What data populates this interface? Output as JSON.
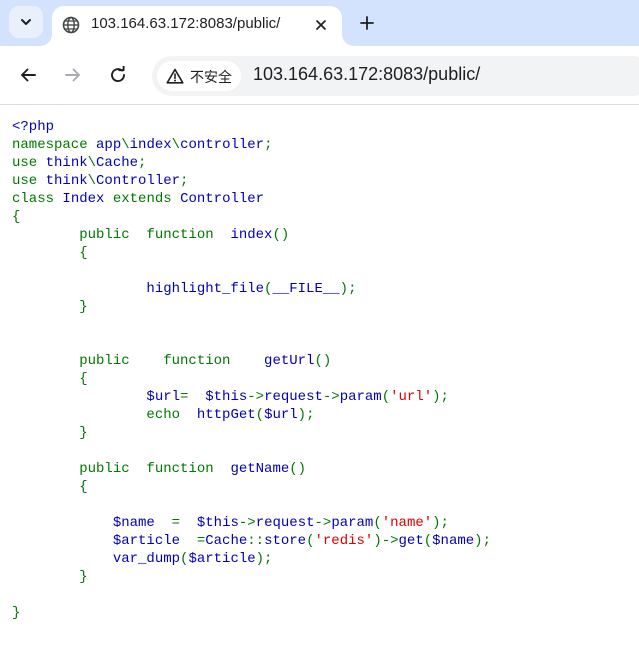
{
  "browser": {
    "tab": {
      "title": "103.164.63.172:8083/public/",
      "favicon": "globe-icon",
      "close": "close-icon"
    },
    "new_tab": "plus-icon",
    "tab_search": "chevron-down-icon",
    "nav": {
      "back": "back-arrow-icon",
      "forward": "forward-arrow-icon",
      "reload": "reload-icon"
    },
    "omnibox": {
      "security_label": "不安全",
      "security_icon": "warning-triangle-icon",
      "url": "103.164.63.172:8083/public/"
    },
    "colors": {
      "frame": "#d3e3fd",
      "code_default": "#0000bb",
      "code_keyword": "#007700",
      "code_string": "#dd0000"
    }
  },
  "source_code": [
    [
      [
        "default",
        "<?php"
      ]
    ],
    [
      [
        "keyword",
        "namespace "
      ],
      [
        "default",
        "app"
      ],
      [
        "keyword",
        "\\"
      ],
      [
        "default",
        "index"
      ],
      [
        "keyword",
        "\\"
      ],
      [
        "default",
        "controller"
      ],
      [
        "keyword",
        ";"
      ]
    ],
    [
      [
        "keyword",
        "use "
      ],
      [
        "default",
        "think"
      ],
      [
        "keyword",
        "\\"
      ],
      [
        "default",
        "Cache"
      ],
      [
        "keyword",
        ";"
      ]
    ],
    [
      [
        "keyword",
        "use "
      ],
      [
        "default",
        "think"
      ],
      [
        "keyword",
        "\\"
      ],
      [
        "default",
        "Controller"
      ],
      [
        "keyword",
        ";"
      ]
    ],
    [
      [
        "keyword",
        "class "
      ],
      [
        "default",
        "Index "
      ],
      [
        "keyword",
        "extends "
      ],
      [
        "default",
        "Controller"
      ]
    ],
    [
      [
        "keyword",
        "{"
      ]
    ],
    [
      [
        "keyword",
        "        public  function  "
      ],
      [
        "default",
        "index"
      ],
      [
        "keyword",
        "()"
      ]
    ],
    [
      [
        "keyword",
        "        {"
      ]
    ],
    [
      [
        "default",
        ""
      ]
    ],
    [
      [
        "default",
        "                highlight_file"
      ],
      [
        "keyword",
        "("
      ],
      [
        "default",
        "__FILE__"
      ],
      [
        "keyword",
        ");"
      ]
    ],
    [
      [
        "keyword",
        "        }"
      ]
    ],
    [
      [
        "default",
        ""
      ]
    ],
    [
      [
        "default",
        ""
      ]
    ],
    [
      [
        "keyword",
        "        public    function    "
      ],
      [
        "default",
        "getUrl"
      ],
      [
        "keyword",
        "()"
      ]
    ],
    [
      [
        "keyword",
        "        {"
      ]
    ],
    [
      [
        "default",
        "                $url"
      ],
      [
        "keyword",
        "=  "
      ],
      [
        "default",
        "$this"
      ],
      [
        "keyword",
        "->"
      ],
      [
        "default",
        "request"
      ],
      [
        "keyword",
        "->"
      ],
      [
        "default",
        "param"
      ],
      [
        "keyword",
        "("
      ],
      [
        "string",
        "'url'"
      ],
      [
        "keyword",
        ");"
      ]
    ],
    [
      [
        "keyword",
        "                echo  "
      ],
      [
        "default",
        "httpGet"
      ],
      [
        "keyword",
        "("
      ],
      [
        "default",
        "$url"
      ],
      [
        "keyword",
        ");"
      ]
    ],
    [
      [
        "keyword",
        "        }"
      ]
    ],
    [
      [
        "default",
        ""
      ]
    ],
    [
      [
        "keyword",
        "        public  function  "
      ],
      [
        "default",
        "getName"
      ],
      [
        "keyword",
        "()"
      ]
    ],
    [
      [
        "keyword",
        "        {"
      ]
    ],
    [
      [
        "default",
        ""
      ]
    ],
    [
      [
        "default",
        "            $name  "
      ],
      [
        "keyword",
        "=  "
      ],
      [
        "default",
        "$this"
      ],
      [
        "keyword",
        "->"
      ],
      [
        "default",
        "request"
      ],
      [
        "keyword",
        "->"
      ],
      [
        "default",
        "param"
      ],
      [
        "keyword",
        "("
      ],
      [
        "string",
        "'name'"
      ],
      [
        "keyword",
        ");"
      ]
    ],
    [
      [
        "default",
        "            $article  "
      ],
      [
        "keyword",
        "="
      ],
      [
        "default",
        "Cache"
      ],
      [
        "keyword",
        "::"
      ],
      [
        "default",
        "store"
      ],
      [
        "keyword",
        "("
      ],
      [
        "string",
        "'redis'"
      ],
      [
        "keyword",
        ")->"
      ],
      [
        "default",
        "get"
      ],
      [
        "keyword",
        "("
      ],
      [
        "default",
        "$name"
      ],
      [
        "keyword",
        ");"
      ]
    ],
    [
      [
        "default",
        "            var_dump"
      ],
      [
        "keyword",
        "("
      ],
      [
        "default",
        "$article"
      ],
      [
        "keyword",
        ");"
      ]
    ],
    [
      [
        "keyword",
        "        }"
      ]
    ],
    [
      [
        "default",
        ""
      ]
    ],
    [
      [
        "keyword",
        "}"
      ]
    ]
  ]
}
